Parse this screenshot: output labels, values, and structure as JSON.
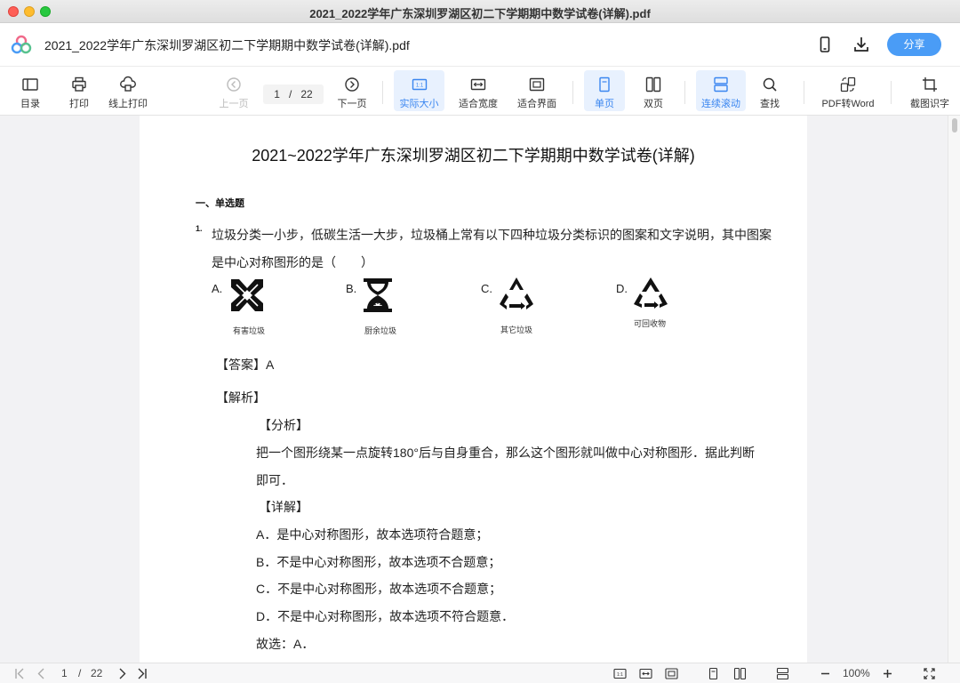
{
  "window": {
    "title": "2021_2022学年广东深圳罗湖区初二下学期期中数学试卷(详解).pdf"
  },
  "header": {
    "file_title": "2021_2022学年广东深圳罗湖区初二下学期期中数学试卷(详解).pdf",
    "share_label": "分享",
    "logo_icon": "app-logo-icon"
  },
  "toolbar": {
    "toc": "目录",
    "print": "打印",
    "online_print": "线上打印",
    "prev_page": "上一页",
    "current_page": "1",
    "page_sep": "/",
    "total_pages": "22",
    "next_page": "下一页",
    "actual_size": "实际大小",
    "fit_width": "适合宽度",
    "fit_page": "适合界面",
    "single_page": "单页",
    "double_page": "双页",
    "continuous_scroll": "连续滚动",
    "find": "查找",
    "pdf_to_word": "PDF转Word",
    "ocr": "截图识字",
    "active_tools": [
      "actual_size",
      "single_page",
      "continuous_scroll"
    ]
  },
  "document": {
    "title": "2021~2022学年广东深圳罗湖区初二下学期期中数学试卷(详解)",
    "section": "一、单选题",
    "question_number": "1.",
    "question_line1": "垃圾分类一小步，低碳生活一大步，垃圾桶上常有以下四种垃圾分类标识的图案和文字说明，其中图案",
    "question_line2": "是中心对称图形的是（　　）",
    "options": [
      {
        "letter": "A.",
        "caption": "有害垃圾",
        "icon": "hazardous-waste-icon"
      },
      {
        "letter": "B.",
        "caption": "厨余垃圾",
        "icon": "kitchen-waste-icon"
      },
      {
        "letter": "C.",
        "caption": "其它垃圾",
        "icon": "other-waste-icon"
      },
      {
        "letter": "D.",
        "caption": "可回收物",
        "icon": "recyclable-icon"
      }
    ],
    "answer": "【答案】A",
    "analysis_head": "【解析】",
    "analysis_sub": "【分析】",
    "analysis_line1": "把一个图形绕某一点旋转180°后与自身重合，那么这个图形就叫做中心对称图形．据此判断",
    "analysis_line2": "即可．",
    "detail_head": "【详解】",
    "detail_lines": [
      "A．是中心对称图形，故本选项符合题意；",
      "B．不是中心对称图形，故本选项不合题意；",
      "C．不是中心对称图形，故本选项不合题意；",
      "D．不是中心对称图形，故本选项不符合题意．"
    ],
    "conclusion": "故选：A．"
  },
  "statusbar": {
    "current_page": "1",
    "page_sep": "/",
    "total_pages": "22",
    "zoom": "100%",
    "actual_size_icon_label": "1:1"
  },
  "colors": {
    "accent": "#4a9cf6",
    "active_bg": "#e8f1fe",
    "active_text": "#3a86f0"
  }
}
